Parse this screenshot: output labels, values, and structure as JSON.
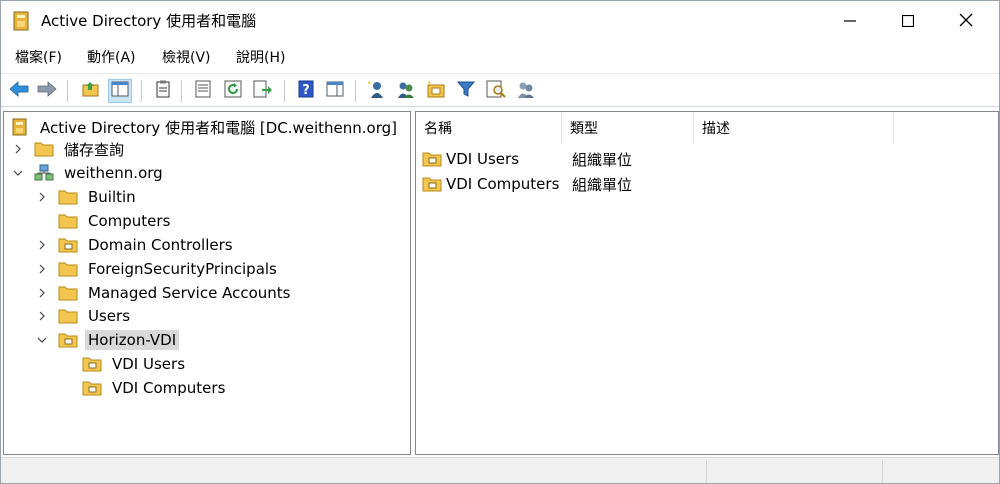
{
  "window": {
    "title": "Active Directory 使用者和電腦",
    "min_icon": "minimize-icon",
    "max_icon": "maximize-icon",
    "close_icon": "close-icon"
  },
  "menu": [
    {
      "label": "檔案(F)"
    },
    {
      "label": "動作(A)"
    },
    {
      "label": "檢視(V)"
    },
    {
      "label": "說明(H)"
    }
  ],
  "toolbar": {
    "buttons": [
      "back-arrow-icon",
      "forward-arrow-icon",
      "up-folder-icon",
      "show-hide-console-tree-icon",
      "properties-icon",
      "export-list-icon",
      "refresh-icon",
      "export-icon",
      "help-icon",
      "show-action-pane-icon",
      "new-user-icon",
      "new-group-icon",
      "new-ou-icon",
      "filter-icon",
      "find-icon",
      "add-to-group-icon"
    ],
    "active": "show-hide-console-tree-icon"
  },
  "tree": {
    "root": "Active Directory 使用者和電腦 [DC.weithenn.org]",
    "saved_queries": "儲存查詢",
    "domain": "weithenn.org",
    "items": [
      {
        "label": "Builtin"
      },
      {
        "label": "Computers"
      },
      {
        "label": "Domain Controllers"
      },
      {
        "label": "ForeignSecurityPrincipals"
      },
      {
        "label": "Managed Service Accounts"
      },
      {
        "label": "Users"
      },
      {
        "label": "Horizon-VDI"
      }
    ],
    "children": [
      {
        "label": "VDI Users"
      },
      {
        "label": "VDI Computers"
      }
    ]
  },
  "list": {
    "columns": [
      "名稱",
      "類型",
      "描述"
    ],
    "rows": [
      {
        "name": "VDI Users",
        "type": "組織單位"
      },
      {
        "name": "VDI Computers",
        "type": "組織單位"
      }
    ]
  },
  "colors": {
    "folder": "#f3c74f",
    "folder_dark": "#d9a520",
    "selection": "#d9d9d9",
    "toolbar_active": "#cce4f7",
    "arrow_blue": "#2f8fd8"
  }
}
